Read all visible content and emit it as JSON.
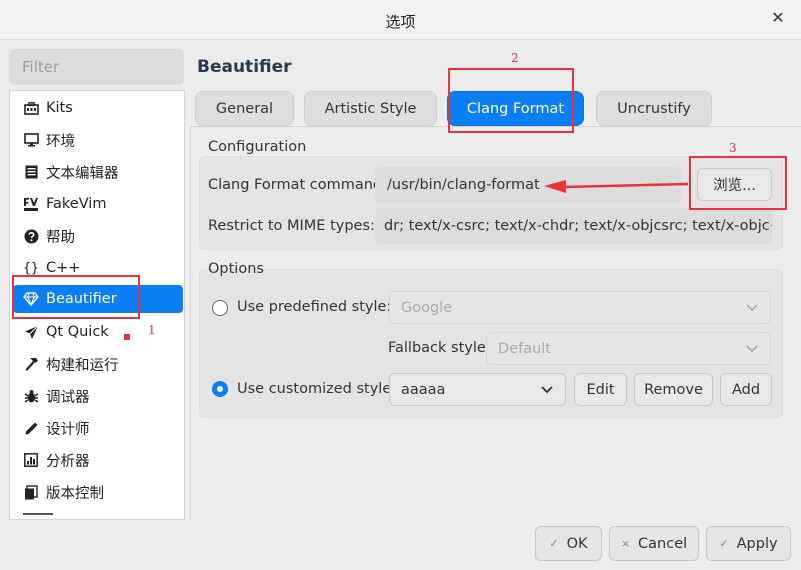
{
  "window": {
    "title": "选项"
  },
  "filter": {
    "placeholder": "Filter"
  },
  "sidebar": {
    "items": [
      {
        "label": "Kits",
        "icon": "kits-icon"
      },
      {
        "label": "环境",
        "icon": "monitor-icon"
      },
      {
        "label": "文本编辑器",
        "icon": "text-editor-icon"
      },
      {
        "label": "FakeVim",
        "icon": "fakevim-icon"
      },
      {
        "label": "帮助",
        "icon": "help-icon"
      },
      {
        "label": "C++",
        "icon": "braces-icon"
      },
      {
        "label": "Beautifier",
        "icon": "diamond-icon"
      },
      {
        "label": "Qt Quick",
        "icon": "paper-plane-icon"
      },
      {
        "label": "构建和运行",
        "icon": "hammer-icon"
      },
      {
        "label": "调试器",
        "icon": "bug-icon"
      },
      {
        "label": "设计师",
        "icon": "pencil-icon"
      },
      {
        "label": "分析器",
        "icon": "analyzer-icon"
      },
      {
        "label": "版本控制",
        "icon": "version-control-icon"
      }
    ],
    "active_index": 6
  },
  "main": {
    "heading": "Beautifier",
    "tabs": [
      "General",
      "Artistic Style",
      "Clang Format",
      "Uncrustify"
    ],
    "active_tab": 2
  },
  "configuration": {
    "title": "Configuration",
    "command_label": "Clang Format command:",
    "command_value": "/usr/bin/clang-format",
    "browse_label": "浏览...",
    "mime_label": "Restrict to MIME types:",
    "mime_value": "dr; text/x-csrc; text/x-chdr; text/x-objcsrc; text/x-objc++src"
  },
  "options": {
    "title": "Options",
    "predefined_label": "Use predefined style:",
    "predefined_value": "Google",
    "fallback_label": "Fallback style:",
    "fallback_value": "Default",
    "customized_label": "Use customized style:",
    "customized_value": "aaaaa",
    "edit_label": "Edit",
    "remove_label": "Remove",
    "add_label": "Add"
  },
  "annotations": {
    "n1": "1",
    "n2": "2",
    "n3": "3"
  },
  "footer": {
    "ok_label": "OK",
    "cancel_label": "Cancel",
    "apply_label": "Apply"
  },
  "colors": {
    "accent": "#0a7ef2",
    "annotation": "#e8333f"
  }
}
